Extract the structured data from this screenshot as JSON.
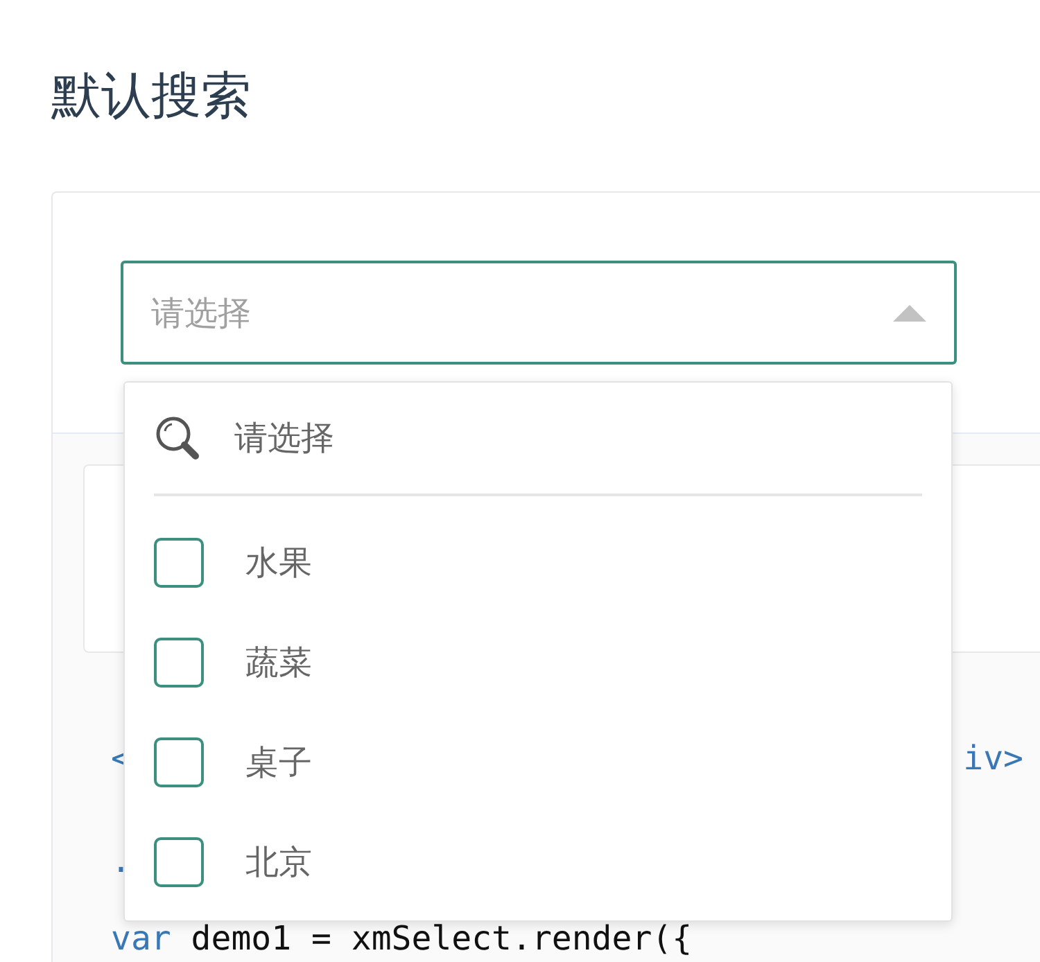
{
  "title": "默认搜索",
  "select": {
    "placeholder": "请选择",
    "expanded": true
  },
  "dropdown": {
    "search": {
      "placeholder": "请选择"
    },
    "options": [
      {
        "label": "水果",
        "checked": false
      },
      {
        "label": "蔬菜",
        "checked": false
      },
      {
        "label": "桌子",
        "checked": false
      },
      {
        "label": "北京",
        "checked": false
      }
    ]
  },
  "code_lines": [
    {
      "left": [
        {
          "text": "<",
          "kind": "keyword"
        }
      ],
      "right": [
        {
          "text": "iv>",
          "kind": "keyword"
        }
      ]
    },
    {
      "left": [
        {
          "text": ".",
          "kind": "keyword"
        }
      ]
    },
    {
      "left": [
        {
          "text": "var",
          "kind": "keyword"
        },
        {
          "text": " demo1 = xmSelect.render({",
          "kind": "plain"
        }
      ]
    }
  ]
}
